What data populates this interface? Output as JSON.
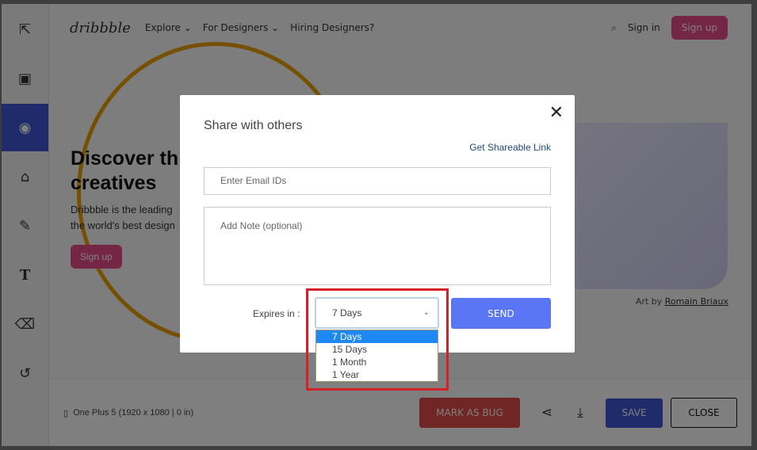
{
  "tools": [
    {
      "icon": "select-add-icon",
      "glyph": "⇱"
    },
    {
      "icon": "rectangle-select-icon",
      "glyph": "▣"
    },
    {
      "icon": "circle-icon",
      "glyph": "◉",
      "active": true
    },
    {
      "icon": "fill-icon",
      "glyph": "⌂"
    },
    {
      "icon": "pen-icon",
      "glyph": "✎"
    },
    {
      "icon": "text-icon",
      "glyph": "T"
    },
    {
      "icon": "eraser-icon",
      "glyph": "⌫"
    },
    {
      "icon": "undo-icon",
      "glyph": "↺"
    }
  ],
  "site": {
    "logo": "dribbble",
    "nav": [
      "Explore ⌄",
      "For Designers ⌄",
      "Hiring Designers?"
    ],
    "sign_in": "Sign in",
    "sign_up": "Sign up",
    "hero_title_1": "Discover th",
    "hero_title_2": "creatives",
    "hero_text_1": "Dribbble is the leading",
    "hero_text_2": "the world's best design",
    "hero_button": "Sign up",
    "credit_prefix": "Art by ",
    "credit_name": "Romain Briaux"
  },
  "bottom": {
    "device": "One Plus 5 (1920 x 1080 | 0 in)",
    "mark_as_bug": "MARK AS BUG",
    "save": "SAVE",
    "close": "CLOSE"
  },
  "modal": {
    "title": "Share with others",
    "close": "✕",
    "shareable_link": "Get Shareable Link",
    "email_placeholder": "Enter Email IDs",
    "note_placeholder": "Add Note (optional)",
    "expires_label": "Expires in :",
    "expires_value": "7 Days",
    "send": "SEND",
    "options": [
      "7 Days",
      "15 Days",
      "1 Month",
      "1 Year"
    ],
    "selected_option": "7 Days"
  },
  "colors": {
    "accent": "#3f56d6",
    "send": "#5b76f5",
    "bug": "#e34b4b",
    "highlight": "#d42027",
    "brand": "#ea4c89"
  }
}
